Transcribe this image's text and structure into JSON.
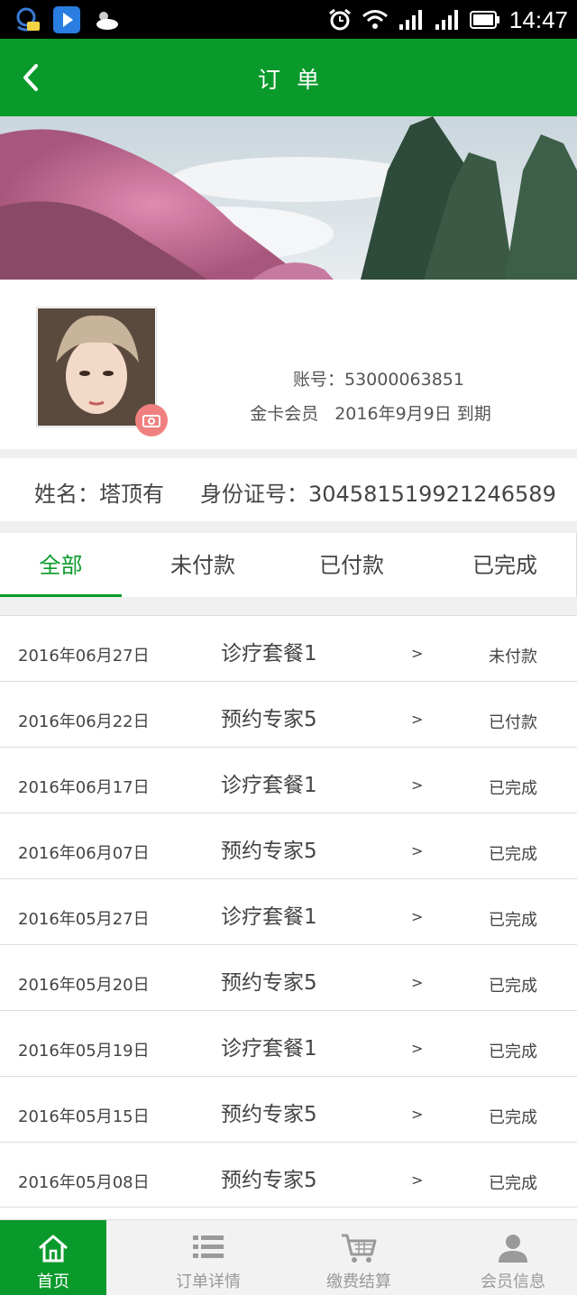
{
  "status_bar": {
    "time": "14:47"
  },
  "header": {
    "title": "订单",
    "back_icon": "chevron-left-icon"
  },
  "profile": {
    "account": "账号：53000063851",
    "member_level": "金卡会员",
    "expiry": "2016年9月9日 到期",
    "name": "姓名：塔顶有",
    "id_number": "身份证号：304581519921246589"
  },
  "tabs": [
    {
      "label": "全部",
      "active": true
    },
    {
      "label": "未付款",
      "active": false
    },
    {
      "label": "已付款",
      "active": false
    },
    {
      "label": "已完成",
      "active": false
    }
  ],
  "orders": [
    {
      "date": "2016年06月27日",
      "name": "诊疗套餐1",
      "arrow": ">",
      "status": "未付款"
    },
    {
      "date": "2016年06月22日",
      "name": "预约专家5",
      "arrow": ">",
      "status": "已付款"
    },
    {
      "date": "2016年06月17日",
      "name": "诊疗套餐1",
      "arrow": ">",
      "status": "已完成"
    },
    {
      "date": "2016年06月07日",
      "name": "预约专家5",
      "arrow": ">",
      "status": "已完成"
    },
    {
      "date": "2016年05月27日",
      "name": "诊疗套餐1",
      "arrow": ">",
      "status": "已完成"
    },
    {
      "date": "2016年05月20日",
      "name": "预约专家5",
      "arrow": ">",
      "status": "已完成"
    },
    {
      "date": "2016年05月19日",
      "name": "诊疗套餐1",
      "arrow": ">",
      "status": "已完成"
    },
    {
      "date": "2016年05月15日",
      "name": "预约专家5",
      "arrow": ">",
      "status": "已完成"
    },
    {
      "date": "2016年05月08日",
      "name": "预约专家5",
      "arrow": ">",
      "status": "已完成"
    }
  ],
  "bottom_nav": [
    {
      "label": "首页",
      "icon": "home-icon",
      "active": true
    },
    {
      "label": "订单详情",
      "icon": "list-icon",
      "active": false
    },
    {
      "label": "缴费结算",
      "icon": "cart-icon",
      "active": false
    },
    {
      "label": "会员信息",
      "icon": "user-icon",
      "active": false
    }
  ],
  "colors": {
    "primary": "#0a9a2b",
    "camera_badge": "#f08080"
  }
}
